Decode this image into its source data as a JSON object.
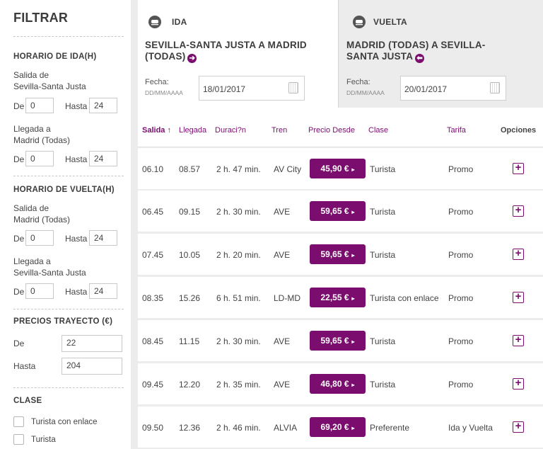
{
  "filter": {
    "title": "FILTRAR",
    "horario_ida": {
      "heading": "HORARIO DE IDA(H)",
      "salida_label": "Salida de\nSevilla-Santa Justa",
      "salida_de": "0",
      "salida_hasta": "24",
      "llegada_label": "Llegada a\nMadrid (Todas)",
      "llegada_de": "0",
      "llegada_hasta": "24"
    },
    "horario_vuelta": {
      "heading": "HORARIO DE VUELTA(H)",
      "salida_label": "Salida de\nMadrid (Todas)",
      "salida_de": "0",
      "salida_hasta": "24",
      "llegada_label": "Llegada a\nSevilla-Santa Justa",
      "llegada_de": "0",
      "llegada_hasta": "24"
    },
    "de_label": "De",
    "hasta_label": "Hasta",
    "precios": {
      "heading": "PRECIOS TRAYECTO (€)",
      "de": "22",
      "hasta": "204"
    },
    "clase": {
      "heading": "CLASE",
      "options": [
        "Turista con enlace",
        "Turista"
      ]
    }
  },
  "tabs": {
    "ida": {
      "name": "IDA",
      "route": "SEVILLA-SANTA JUSTA A MADRID (TODAS)",
      "fecha_label": "Fecha:",
      "fecha_format": "DD/MM/AAAA",
      "date": "18/01/2017"
    },
    "vuelta": {
      "name": "VUELTA",
      "route": "MADRID (TODAS) A SEVILLA-SANTA JUSTA",
      "fecha_label": "Fecha:",
      "fecha_format": "DD/MM/AAAA",
      "date": "20/01/2017"
    }
  },
  "table": {
    "headers": {
      "salida": "Salida ↑",
      "llegada": "Llegada",
      "duracion": "Duraci?n",
      "tren": "Tren",
      "precio": "Precio Desde",
      "clase": "Clase",
      "tarifa": "Tarifa",
      "opciones": "Opciones"
    },
    "rows": [
      {
        "salida": "06.10",
        "llegada": "08.57",
        "duracion": "2 h. 47 min.",
        "tren": "AV City",
        "precio": "45,90 €",
        "clase": "Turista",
        "tarifa": "Promo"
      },
      {
        "salida": "06.45",
        "llegada": "09.15",
        "duracion": "2 h. 30 min.",
        "tren": "AVE",
        "precio": "59,65 €",
        "clase": "Turista",
        "tarifa": "Promo"
      },
      {
        "salida": "07.45",
        "llegada": "10.05",
        "duracion": "2 h. 20 min.",
        "tren": "AVE",
        "precio": "59,65 €",
        "clase": "Turista",
        "tarifa": "Promo"
      },
      {
        "salida": "08.35",
        "llegada": "15.26",
        "duracion": "6 h. 51 min.",
        "tren": "LD-MD",
        "precio": "22,55 €",
        "clase": "Turista con enlace",
        "tarifa": "Promo"
      },
      {
        "salida": "08.45",
        "llegada": "11.15",
        "duracion": "2 h. 30 min.",
        "tren": "AVE",
        "precio": "59,65 €",
        "clase": "Turista",
        "tarifa": "Promo"
      },
      {
        "salida": "09.45",
        "llegada": "12.20",
        "duracion": "2 h. 35 min.",
        "tren": "AVE",
        "precio": "46,80 €",
        "clase": "Turista",
        "tarifa": "Promo"
      },
      {
        "salida": "09.50",
        "llegada": "12.36",
        "duracion": "2 h. 46 min.",
        "tren": "ALVIA",
        "precio": "69,20 €",
        "clase": "Preferente",
        "tarifa": "Ida y Vuelta"
      }
    ]
  },
  "colors": {
    "accent": "#7b0d6f",
    "background": "#ececec"
  },
  "icons": {
    "train": "train-icon",
    "calendar": "calendar-icon",
    "add": "plus-icon",
    "arrow_right": "arrow-right-circle-icon",
    "arrow_left": "arrow-left-circle-icon",
    "checkbox": "checkbox"
  }
}
